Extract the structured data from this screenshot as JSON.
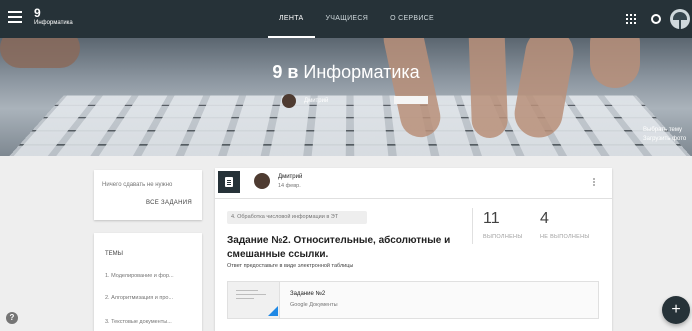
{
  "header": {
    "class_number": "9",
    "class_name": "Информатика",
    "nav": [
      "ЛЕНТА",
      "УЧАЩИЕСЯ",
      "О СЕРВИСЕ"
    ],
    "active_tab": "ЛЕНТА"
  },
  "banner": {
    "title_strong": "9 в",
    "title_light": "Информатика",
    "teacher_name": "Дмитрий",
    "links": [
      "Выбрать тему",
      "Загрузить фото"
    ]
  },
  "sidebar": {
    "due_text": "Ничего сдавать не нужно",
    "all_tasks": "ВСЕ ЗАДАНИЯ",
    "topics_header": "ТЕМЫ",
    "topics": [
      "1. Моделирование и фор...",
      "2. Алгоритмизация и про...",
      "3. Текстовые документы..."
    ]
  },
  "post": {
    "author": "Дмитрий",
    "date": "14 февр.",
    "topic_chip": "4. Обработка числовой информации в ЭТ",
    "title": "Задание №2. Относительные, абсолютные и смешанные ссылки.",
    "description": "Ответ предоставьте в виде электронной таблицы",
    "stats": [
      {
        "value": "11",
        "label": "ВЫПОЛНЕНЫ"
      },
      {
        "value": "4",
        "label": "НЕ ВЫПОЛНЕНЫ"
      }
    ],
    "attachment": {
      "title": "Задание №2",
      "source": "Google Документы"
    }
  },
  "icons": {
    "help": "?",
    "fab": "+"
  },
  "colors": {
    "topbar": "#263238",
    "accent_fab": "#263238",
    "page_bg": "#eeeeee"
  }
}
